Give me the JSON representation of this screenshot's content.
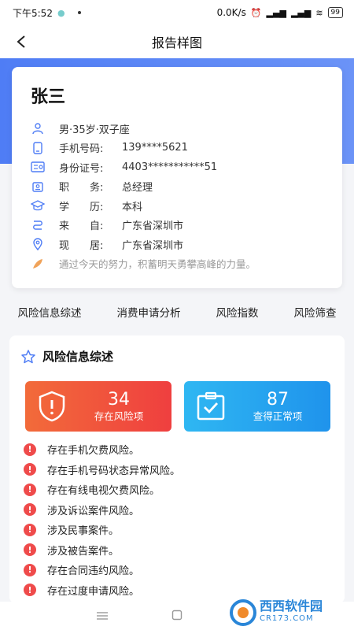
{
  "status_bar": {
    "time": "下午5:52",
    "speed": "0.0K/s",
    "battery": "99"
  },
  "nav": {
    "title": "报告样图"
  },
  "profile": {
    "name": "张三",
    "basic": "男·35岁·双子座",
    "phone": {
      "label": "手机号码:",
      "value": "139****5621"
    },
    "id_card": {
      "label": "身份证号:",
      "value": "4403***********51"
    },
    "position": {
      "label": "职　　务:",
      "value": "总经理"
    },
    "education": {
      "label": "学　　历:",
      "value": "本科"
    },
    "origin": {
      "label": "来　　自:",
      "value": "广东省深圳市"
    },
    "residence": {
      "label": "现　　居:",
      "value": "广东省深圳市"
    },
    "motto": "通过今天的努力，积蓄明天勇攀高峰的力量。"
  },
  "tabs": [
    {
      "label": "风险信息综述"
    },
    {
      "label": "消费申请分析"
    },
    {
      "label": "风险指数"
    },
    {
      "label": "风险筛查"
    }
  ],
  "risk_summary": {
    "title": "风险信息综述",
    "risk_count": "34",
    "risk_label": "存在风险项",
    "normal_count": "87",
    "normal_label": "查得正常项",
    "items": [
      "存在手机欠费风险。",
      "存在手机号码状态异常风险。",
      "存在有线电视欠费风险。",
      "涉及诉讼案件风险。",
      "涉及民事案件。",
      "涉及被告案件。",
      "存在合同违约风险。",
      "存在过度申请风险。"
    ]
  },
  "watermark": {
    "brand": "西西软件园",
    "domain": "CR173.COM"
  },
  "colors": {
    "primary": "#4f7df5",
    "risk": "#ef4b4b",
    "normal": "#1f93ec"
  }
}
